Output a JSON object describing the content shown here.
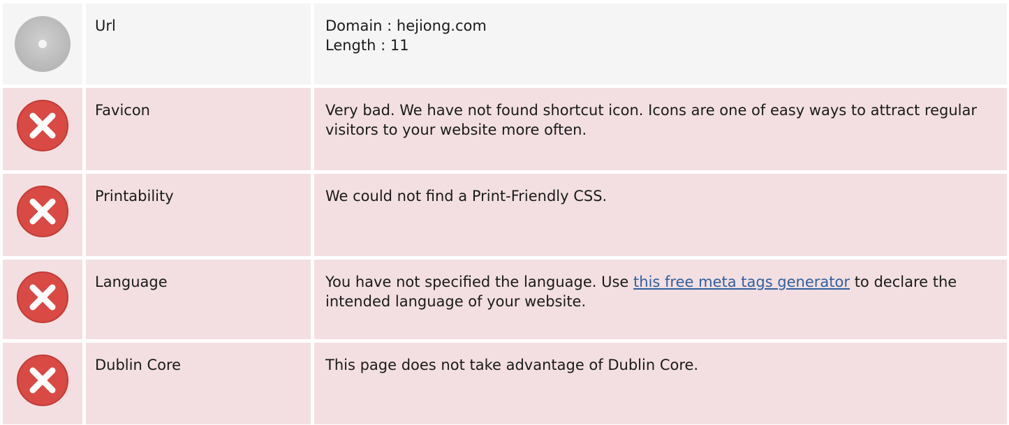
{
  "rows": [
    {
      "status": "info",
      "icon": "gray-disc-icon",
      "label": "Url",
      "lines": [
        "Domain : hejiong.com",
        "Length : 11"
      ]
    },
    {
      "status": "error",
      "icon": "error-x-icon",
      "label": "Favicon",
      "text": "Very bad. We have not found shortcut icon. Icons are one of easy ways to attract regular visitors to your website more often."
    },
    {
      "status": "error",
      "icon": "error-x-icon",
      "label": "Printability",
      "text": "We could not find a Print-Friendly CSS."
    },
    {
      "status": "error",
      "icon": "error-x-icon",
      "label": "Language",
      "text_before": "You have not specified the language. Use ",
      "link_text": "this free meta tags generator",
      "text_after": " to declare the intended language of your website."
    },
    {
      "status": "error",
      "icon": "error-x-icon",
      "label": "Dublin Core",
      "text": "This page does not take advantage of Dublin Core."
    }
  ],
  "colors": {
    "info_bg": "#f5f5f5",
    "error_bg": "#f3dfe1",
    "error_icon": "#d94a45",
    "disc_icon": "#bdbdbd",
    "link": "#2f5f9e"
  }
}
